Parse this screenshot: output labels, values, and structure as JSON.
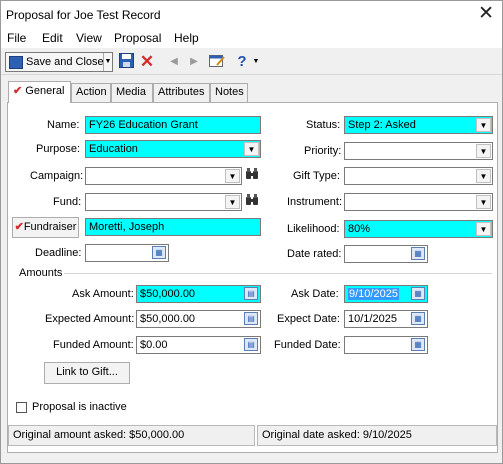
{
  "window": {
    "title": "Proposal for Joe Test Record",
    "close_glyph": "✕"
  },
  "menu": [
    "File",
    "Edit",
    "View",
    "Proposal",
    "Help"
  ],
  "toolbar": {
    "save_close_label": "Save and Close",
    "help_glyph": "?"
  },
  "tabs": [
    "General",
    "Action",
    "Media",
    "Attributes",
    "Notes"
  ],
  "fields": {
    "name_label": "Name:",
    "name_value": "FY26 Education Grant",
    "purpose_label": "Purpose:",
    "purpose_value": "Education",
    "campaign_label": "Campaign:",
    "campaign_value": "",
    "fund_label": "Fund:",
    "fund_value": "",
    "fundraiser_button": "Fundraiser",
    "fundraiser_value": "Moretti, Joseph",
    "deadline_label": "Deadline:",
    "deadline_value": "",
    "status_label": "Status:",
    "status_value": "Step 2: Asked",
    "priority_label": "Priority:",
    "priority_value": "",
    "gift_type_label": "Gift Type:",
    "gift_type_value": "",
    "instrument_label": "Instrument:",
    "instrument_value": "",
    "likelihood_label": "Likelihood:",
    "likelihood_value": "80%",
    "date_rated_label": "Date rated:",
    "date_rated_value": ""
  },
  "amounts": {
    "section_label": "Amounts",
    "ask_amount_label": "Ask Amount:",
    "ask_amount_value": "$50,000.00",
    "expected_amount_label": "Expected Amount:",
    "expected_amount_value": "$50,000.00",
    "funded_amount_label": "Funded Amount:",
    "funded_amount_value": "$0.00",
    "ask_date_label": "Ask Date:",
    "ask_date_value": "9/10/2025",
    "expect_date_label": "Expect Date:",
    "expect_date_value": "10/1/2025",
    "funded_date_label": "Funded Date:",
    "funded_date_value": ""
  },
  "link_to_gift_button": "Link to Gift...",
  "inactive_checkbox_label": "Proposal is inactive",
  "status_bar": {
    "original_amount": "Original amount asked: $50,000.00",
    "original_date": "Original date asked: 9/10/2025"
  },
  "colors": {
    "required_field": "#00ffff",
    "accent": "#2d5fb3"
  }
}
